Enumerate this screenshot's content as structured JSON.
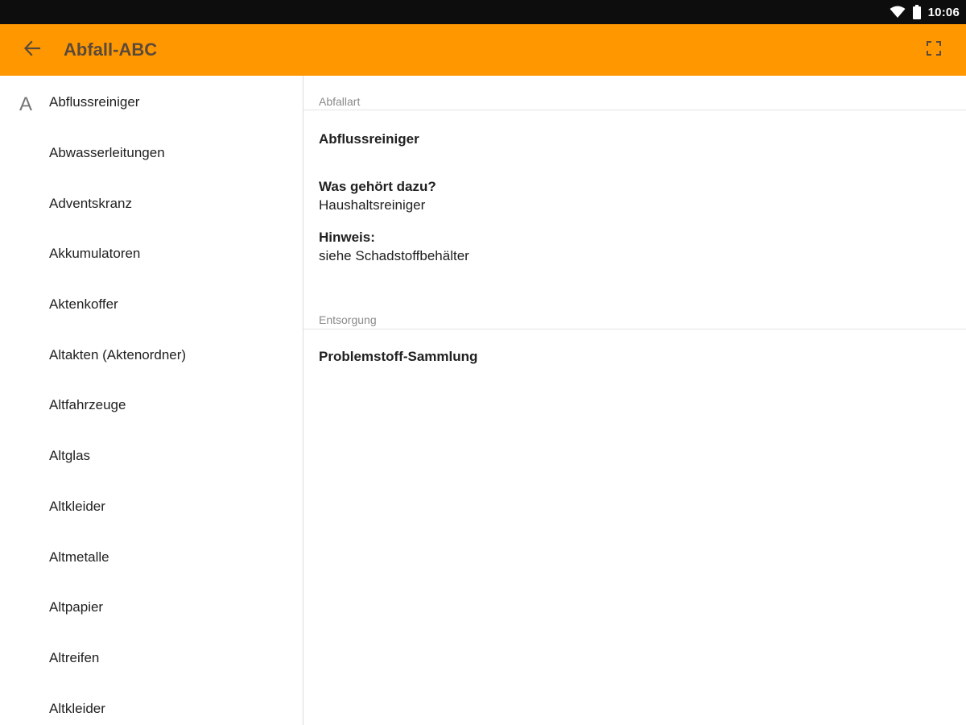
{
  "status_bar": {
    "time": "10:06",
    "icons": [
      "wifi-icon",
      "battery-icon"
    ]
  },
  "app_bar": {
    "title": "Abfall-ABC",
    "back_icon": "arrow-back-icon",
    "fullscreen_icon": "fullscreen-icon",
    "background_color": "#ff9800"
  },
  "sidebar": {
    "section_letter": "A",
    "items": [
      {
        "label": "Abflussreiniger"
      },
      {
        "label": "Abwasserleitungen"
      },
      {
        "label": "Adventskranz"
      },
      {
        "label": "Akkumulatoren"
      },
      {
        "label": "Aktenkoffer"
      },
      {
        "label": "Altakten (Aktenordner)"
      },
      {
        "label": "Altfahrzeuge"
      },
      {
        "label": "Altglas"
      },
      {
        "label": "Altkleider"
      },
      {
        "label": "Altmetalle"
      },
      {
        "label": "Altpapier"
      },
      {
        "label": "Altreifen"
      },
      {
        "label": "Altkleider"
      }
    ]
  },
  "detail": {
    "waste_type_header": "Abfallart",
    "waste_type_name": "Abflussreiniger",
    "includes_label": "Was gehört dazu?",
    "includes_value": "Haushaltsreiniger",
    "note_label": "Hinweis:",
    "note_value": "siehe Schadstoffbehälter",
    "disposal_header": "Entsorgung",
    "disposal_value": "Problemstoff-Sammlung"
  }
}
